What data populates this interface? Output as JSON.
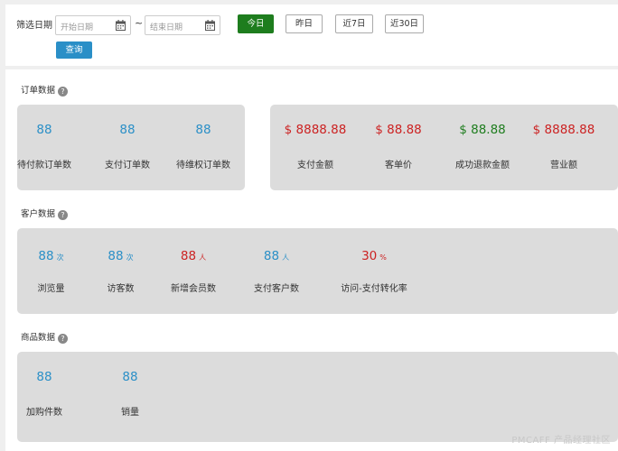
{
  "filter": {
    "label": "筛选日期",
    "start_placeholder": "开始日期",
    "end_placeholder": "结束日期",
    "separator": "~",
    "quick_buttons": [
      {
        "label": "今日",
        "active": true
      },
      {
        "label": "昨日",
        "active": false
      },
      {
        "label": "近7日",
        "active": false
      },
      {
        "label": "近30日",
        "active": false
      }
    ],
    "query_label": "查询"
  },
  "orders": {
    "title": "订单数据",
    "help": "?",
    "counts": [
      {
        "value": "88",
        "label": "待付款订单数"
      },
      {
        "value": "88",
        "label": "支付订单数"
      },
      {
        "value": "88",
        "label": "待维权订单数"
      }
    ],
    "amounts": [
      {
        "value": "$ 8888.88",
        "label": "支付金额",
        "color": "red"
      },
      {
        "value": "$ 88.88",
        "label": "客单价",
        "color": "red"
      },
      {
        "value": "$ 88.88",
        "label": "成功退款金额",
        "color": "green"
      },
      {
        "value": "$ 8888.88",
        "label": "营业额",
        "color": "red"
      }
    ]
  },
  "customers": {
    "title": "客户数据",
    "help": "?",
    "metrics": [
      {
        "value": "88",
        "unit": "次",
        "label": "浏览量",
        "color": "blue"
      },
      {
        "value": "88",
        "unit": "次",
        "label": "访客数",
        "color": "blue"
      },
      {
        "value": "88",
        "unit": "人",
        "label": "新增会员数",
        "color": "red"
      },
      {
        "value": "88",
        "unit": "人",
        "label": "支付客户数",
        "color": "blue"
      },
      {
        "value": "30",
        "unit": "%",
        "label": "访问-支付转化率",
        "color": "red"
      }
    ]
  },
  "products": {
    "title": "商品数据",
    "help": "?",
    "metrics": [
      {
        "value": "88",
        "label": "加购件数"
      },
      {
        "value": "88",
        "label": "销量"
      }
    ]
  },
  "colors": {
    "blue": "#2a8fc7",
    "red": "#cc2222",
    "green": "#1e7d1e"
  },
  "watermark": "PMCAFF 产品经理社区"
}
